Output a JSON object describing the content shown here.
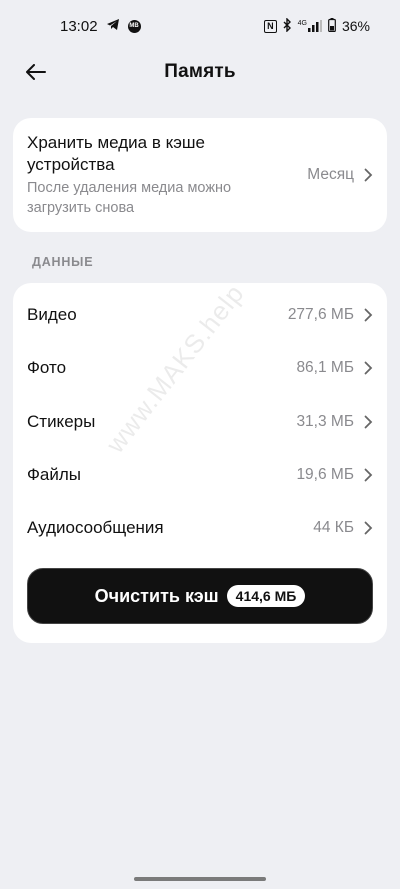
{
  "status_bar": {
    "time": "13:02",
    "nfc": "N",
    "network": "4G",
    "battery": "36%"
  },
  "header": {
    "title": "Память"
  },
  "cache_setting": {
    "title": "Хранить медиа в кэше устройства",
    "subtitle": "После удаления медиа можно загрузить снова",
    "value": "Месяц"
  },
  "section": {
    "label": "ДАННЫЕ"
  },
  "data_rows": [
    {
      "label": "Видео",
      "size": "277,6 МБ"
    },
    {
      "label": "Фото",
      "size": "86,1 МБ"
    },
    {
      "label": "Стикеры",
      "size": "31,3 МБ"
    },
    {
      "label": "Файлы",
      "size": "19,6 МБ"
    },
    {
      "label": "Аудиосообщения",
      "size": "44 КБ"
    }
  ],
  "clear_button": {
    "label": "Очистить кэш",
    "size": "414,6 МБ"
  },
  "watermark": "www.MAKS.help"
}
